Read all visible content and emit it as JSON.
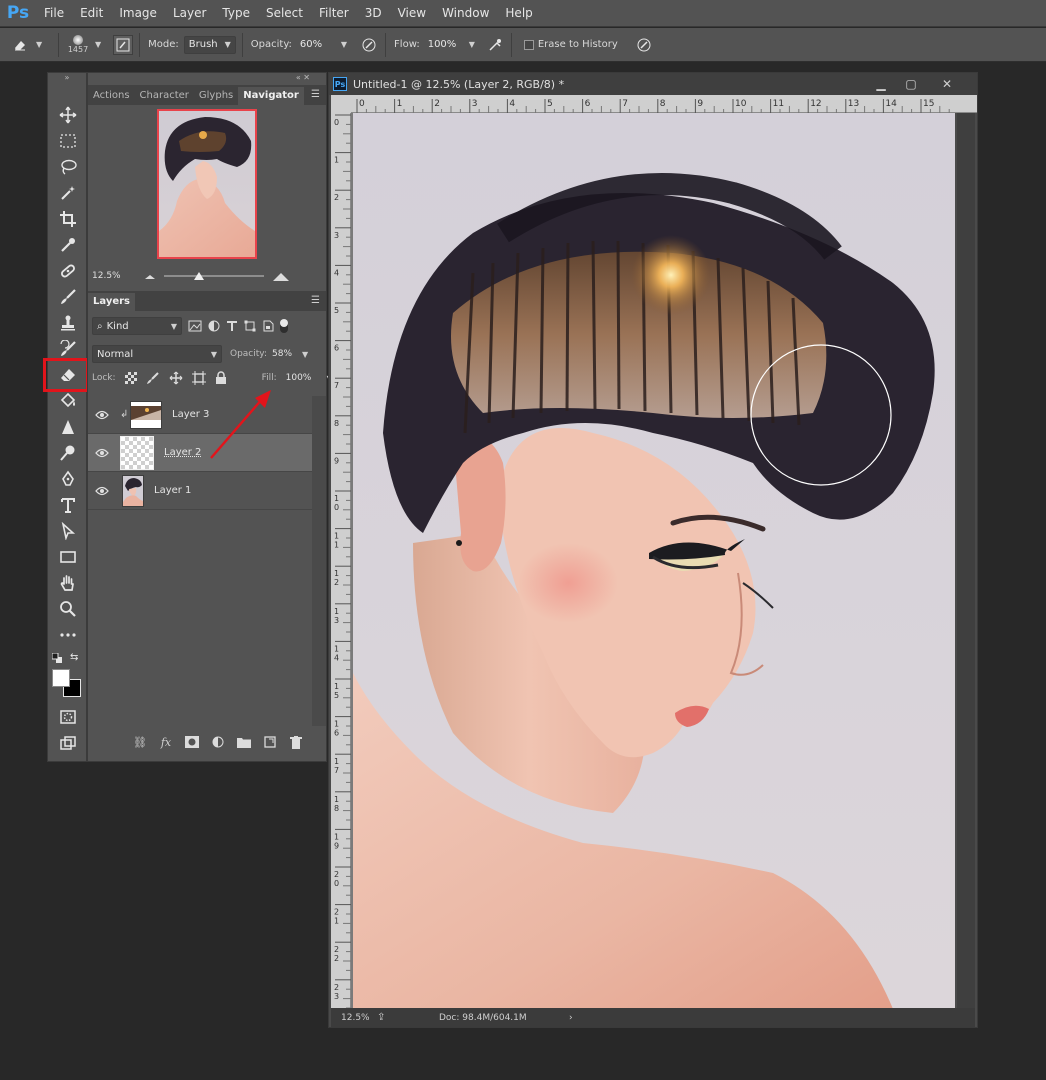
{
  "app": {
    "logo": "Ps"
  },
  "menu": [
    "File",
    "Edit",
    "Image",
    "Layer",
    "Type",
    "Select",
    "Filter",
    "3D",
    "View",
    "Window",
    "Help"
  ],
  "options": {
    "brush_size": "1457",
    "mode_label": "Mode:",
    "mode_value": "Brush",
    "opacity_label": "Opacity:",
    "opacity_value": "60%",
    "flow_label": "Flow:",
    "flow_value": "100%",
    "erase_history_label": "Erase to History"
  },
  "panel_tabs": [
    "Actions",
    "Character",
    "Glyphs",
    "Navigator"
  ],
  "navigator": {
    "zoom": "12.5%"
  },
  "layers_panel": {
    "tab": "Layers",
    "filter_kind": "Kind",
    "blend_mode": "Normal",
    "opacity_label": "Opacity:",
    "opacity_value": "58%",
    "lock_label": "Lock:",
    "fill_label": "Fill:",
    "fill_value": "100%",
    "layers": [
      {
        "name": "Layer 3",
        "clipped": true
      },
      {
        "name": "Layer 2",
        "selected": true
      },
      {
        "name": "Layer 1"
      }
    ]
  },
  "document": {
    "title": "Untitled-1 @ 12.5% (Layer 2, RGB/8) *",
    "tab_icon": "Ps",
    "zoom": "12.5%",
    "doc_info": "Doc: 98.4M/604.1M",
    "ruler_top": [
      "0",
      "1",
      "2",
      "3",
      "4",
      "5",
      "6",
      "7",
      "8",
      "9",
      "10",
      "11",
      "12",
      "13",
      "14",
      "15"
    ],
    "ruler_left": [
      "0",
      "1",
      "2",
      "3",
      "4",
      "5",
      "6",
      "7",
      "8",
      "9",
      "10",
      "11",
      "12",
      "13",
      "14",
      "15",
      "16",
      "17",
      "18",
      "19",
      "20",
      "21",
      "22",
      "23"
    ]
  },
  "colors": {
    "accent_red": "#e2141b",
    "arrow_red": "#e2141b",
    "ps_blue": "#46a7f5"
  },
  "icons": {
    "tools": [
      "move-icon",
      "marquee-icon",
      "lasso-icon",
      "magic-wand-icon",
      "crop-icon",
      "eyedropper-icon",
      "healing-icon",
      "brush-icon",
      "stamp-icon",
      "history-brush-icon",
      "eraser-icon",
      "paint-bucket-icon",
      "blur-icon",
      "dodge-icon",
      "pen-icon",
      "type-icon",
      "path-select-icon",
      "rectangle-icon",
      "hand-icon",
      "zoom-icon",
      "more-tools-icon"
    ]
  }
}
